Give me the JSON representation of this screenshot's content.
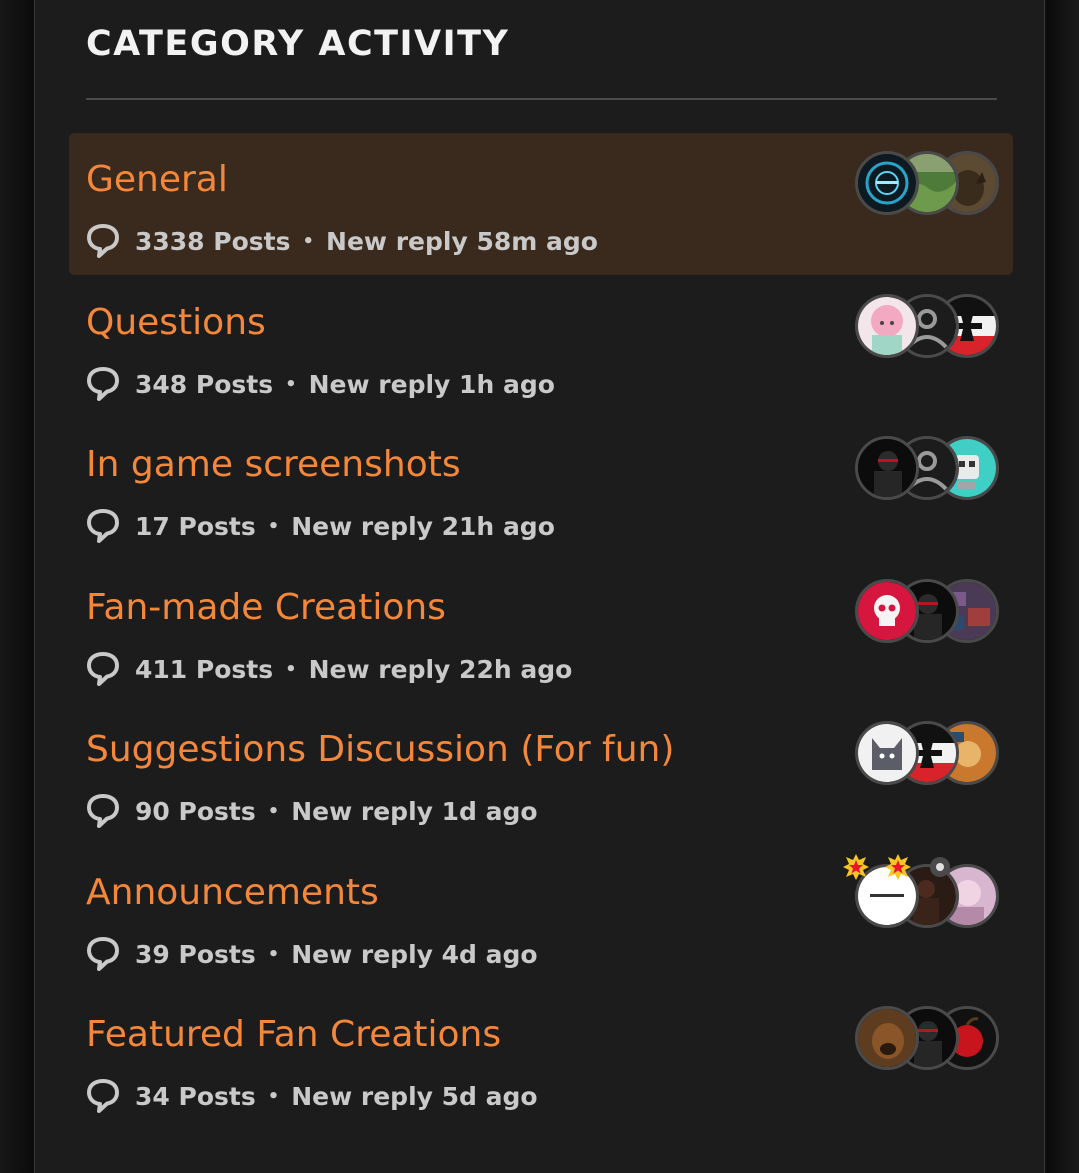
{
  "panel": {
    "title": "CATEGORY ACTIVITY"
  },
  "colors": {
    "accent": "#f5873a",
    "active_bg": "#3a2a1e",
    "panel_bg": "#1c1c1c",
    "meta_text": "#c9c9c9"
  },
  "categories": [
    {
      "name": "General",
      "posts": "3338 Posts",
      "reply": "New reply 58m ago",
      "active": true,
      "avatars": [
        "user-avatar-blue-tech",
        "user-avatar-green-landscape",
        "user-avatar-dog"
      ]
    },
    {
      "name": "Questions",
      "posts": "348 Posts",
      "reply": "New reply 1h ago",
      "active": false,
      "avatars": [
        "user-avatar-pink-anime",
        "default-user-avatar",
        "user-avatar-iron-cross-flag"
      ]
    },
    {
      "name": "In game screenshots",
      "posts": "17 Posts",
      "reply": "New reply 21h ago",
      "active": false,
      "avatars": [
        "user-avatar-dark-figure",
        "default-user-avatar",
        "user-avatar-teal-robot"
      ]
    },
    {
      "name": "Fan-made Creations",
      "posts": "411 Posts",
      "reply": "New reply 22h ago",
      "active": false,
      "avatars": [
        "user-avatar-red-skull",
        "user-avatar-dark-figure",
        "user-avatar-purple-collage"
      ]
    },
    {
      "name": "Suggestions Discussion (For fun)",
      "posts": "90 Posts",
      "reply": "New reply 1d ago",
      "active": false,
      "avatars": [
        "user-avatar-gray-cat",
        "user-avatar-iron-cross-flag",
        "user-avatar-orange-collage"
      ]
    },
    {
      "name": "Announcements",
      "posts": "39 Posts",
      "reply": "New reply 4d ago",
      "active": false,
      "avatars": [
        "user-avatar-white-logo",
        "user-avatar-dark-soldier",
        "user-avatar-pink-photo"
      ],
      "badges": [
        "star-badge-icon",
        "star-badge-icon",
        "gear-badge-icon"
      ]
    },
    {
      "name": "Featured Fan Creations",
      "posts": "34 Posts",
      "reply": "New reply 5d ago",
      "active": false,
      "avatars": [
        "user-avatar-brown-dog",
        "user-avatar-dark-figure",
        "user-avatar-red-apple"
      ]
    }
  ]
}
